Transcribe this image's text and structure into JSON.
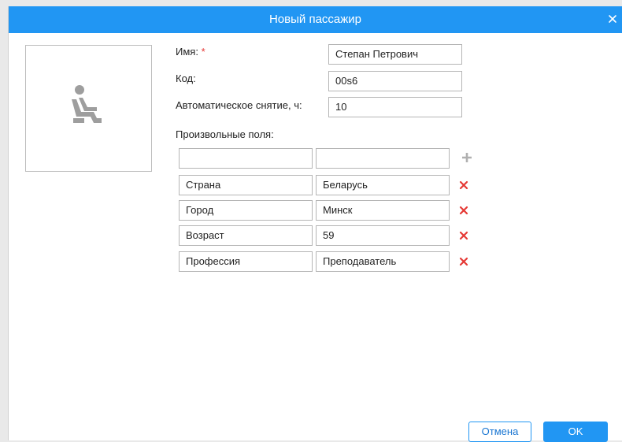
{
  "dialog": {
    "title": "Новый пассажир",
    "name_label": "Имя:",
    "required_mark": "*",
    "name_value": "Степан Петрович",
    "code_label": "Код:",
    "code_value": "00s6",
    "auto_label": "Автоматическое снятие, ч:",
    "auto_value": "10",
    "custom_fields_label": "Произвольные поля:",
    "new_field": {
      "name": "",
      "value": ""
    },
    "fields": [
      {
        "name": "Страна",
        "value": "Беларусь"
      },
      {
        "name": "Город",
        "value": "Минск"
      },
      {
        "name": "Возраст",
        "value": "59"
      },
      {
        "name": "Профессия",
        "value": "Преподаватель"
      }
    ],
    "cancel_label": "Отмена",
    "ok_label": "OK"
  },
  "icons": {
    "close": "close-icon",
    "photo": "passenger-seat-icon",
    "add": "plus-icon",
    "delete": "delete-x-icon"
  },
  "colors": {
    "accent": "#2196f3",
    "delete": "#e53935",
    "placeholder_icon": "#9e9e9e"
  }
}
